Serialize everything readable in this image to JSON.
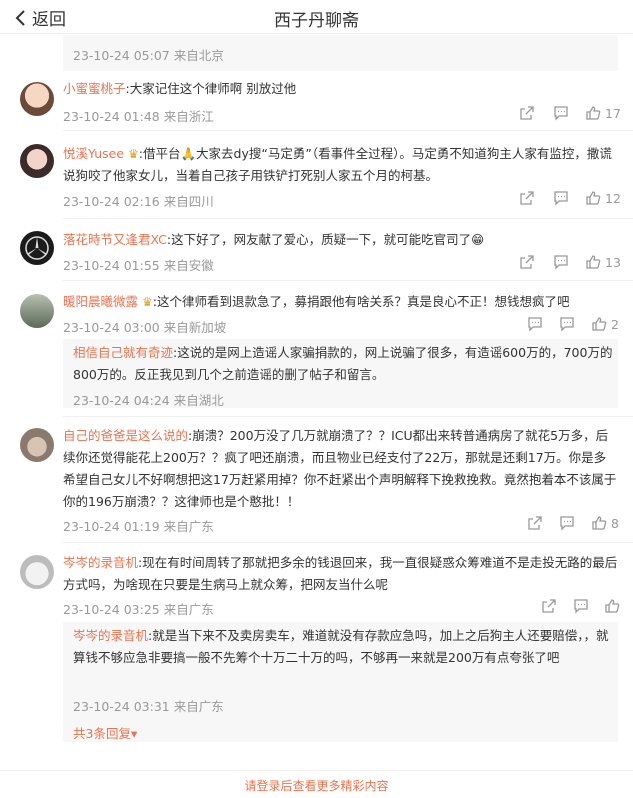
{
  "header": {
    "back_label": "返回",
    "title": "西子丹聊斋"
  },
  "top_reply": {
    "meta": "23-10-24 05:07 来自北京"
  },
  "comments": [
    {
      "name": "小蜜蜜桃子",
      "text": ":大家记住这个律师啊 别放过他",
      "meta": "23-10-24 01:48 来自浙江",
      "likes": "17"
    },
    {
      "name": "悦溪Yusee",
      "text": ":借平台🙏大家去dy搜“马定勇”（看事件全过程）。马定勇不知道狗主人家有监控，撒谎说狗咬了他家女儿，当着自己孩子用铁铲打死别人家五个月的柯基。",
      "meta": "23-10-24 02:16 来自四川",
      "likes": "12"
    },
    {
      "name": "落花時节又逢君XC",
      "text": ":这下好了，网友献了爱心，质疑一下，就可能吃官司了😁",
      "meta": "23-10-24 01:55 来自安徽",
      "likes": "13"
    },
    {
      "name": "暖阳晨曦微露",
      "text": ":这个律师看到退款急了，募捐跟他有啥关系？真是良心不正！想钱想疯了吧",
      "meta": "23-10-24 03:00 来自新加坡",
      "likes": "2",
      "reply": {
        "name": "相信自己就有奇迹",
        "text": ":这说的是网上造谣人家骗捐款的，网上说骗了很多，有造谣600万的，700万的800万的。反正我见到几个之前造谣的删了帖子和留言。",
        "meta": "23-10-24 04:24 来自湖北"
      }
    },
    {
      "name": "自己的爸爸是这么说的",
      "text": ":崩溃？200万没了几万就崩溃了？？ICU都出来转普通病房了就花5万多，后续你还觉得能花上200万？？疯了吧还崩溃，而且物业已经支付了22万，那就是还剩17万。你是多希望自己女儿不好啊想把这17万赶紧用掉？你不赶紧出个声明解释下挽救挽救。竟然抱着本不该属于你的196万崩溃？？这律师也是个憨批！！",
      "meta": "23-10-24 01:19 来自广东",
      "likes": "8"
    },
    {
      "name": "岑岑的录音机",
      "text": ":现在有时间周转了那就把多余的钱退回来，我一直很疑惑众筹难道不是走投无路的最后方式吗，为啥现在只要是生病马上就众筹，把网友当什么呢",
      "meta": "23-10-24 03:25 来自广东",
      "likes": "",
      "reply": {
        "name": "岑岑的录音机",
        "text": ":就是当下来不及卖房卖车，难道就没有存款应急吗，加上之后狗主人还要赔偿，，就算钱不够应急非要搞一般不先筹个十万二十万的吗，不够再一来就是200万有点夸张了吧",
        "meta": "23-10-24 03:31 来自广东"
      },
      "more_replies": "共3条回复▾"
    }
  ],
  "footer": {
    "text": "请登录后查看更多精彩内容"
  }
}
